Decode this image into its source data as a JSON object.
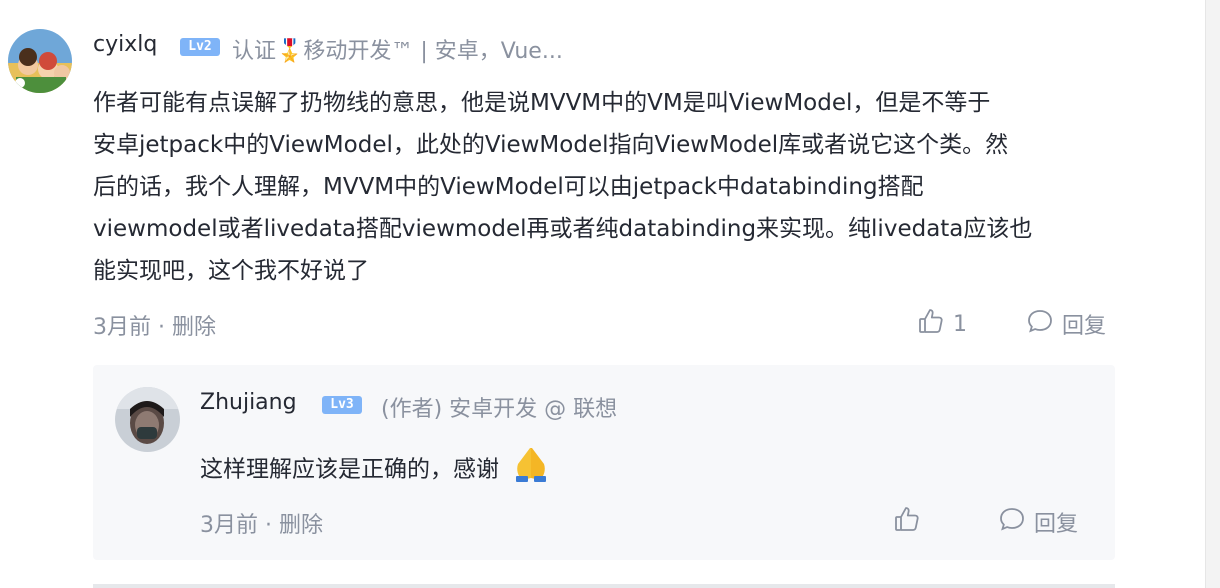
{
  "main_comment": {
    "username": "cyixlq",
    "level": "Lv2",
    "meta": "认证🎖️移动开发™ | 安卓，Vue...",
    "text": "作者可能有点误解了扔物线的意思，他是说MVVM中的VM是叫ViewModel，但是不等于\n安卓jetpack中的ViewModel，此处的ViewModel指向ViewModel库或者说它这个类。然\n后的话，我个人理解，MVVM中的ViewModel可以由jetpack中databinding搭配\nviewmodel或者livedata搭配viewmodel再或者纯databinding来实现。纯livedata应该也\n能实现吧，这个我不好说了",
    "time": "3月前",
    "separator": " · ",
    "delete_label": "删除",
    "like_count": "1",
    "reply_label": "回复",
    "icons": {
      "like": "thumbs-up-icon",
      "reply": "comment-bubble-icon"
    }
  },
  "reply": {
    "username": "Zhujiang",
    "level": "Lv3",
    "meta": "(作者) 安卓开发 @ 联想",
    "text": "这样理解应该是正确的，感谢",
    "emoji": "pray-emoji-icon",
    "time": "3月前",
    "separator": " · ",
    "delete_label": "删除",
    "reply_label": "回复"
  },
  "colors": {
    "text_primary": "#252933",
    "text_secondary": "#8a919f",
    "badge_bg": "#7fb4f8",
    "reply_bg": "#f7f8fa"
  }
}
